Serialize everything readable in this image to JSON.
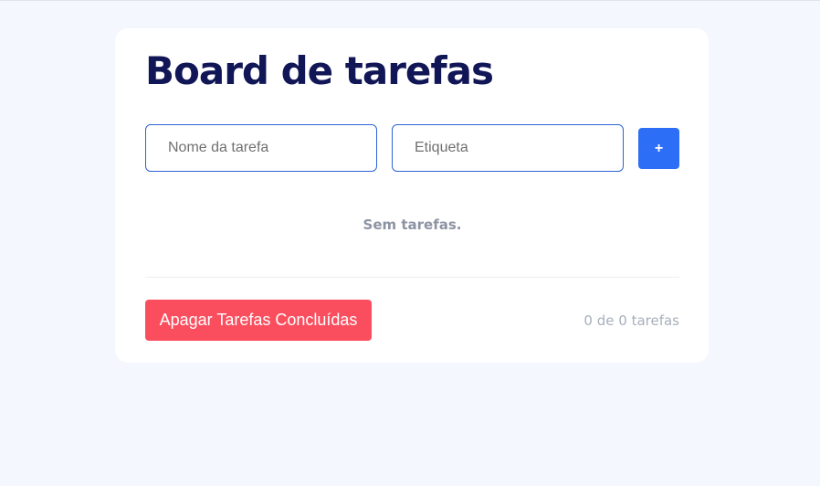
{
  "board": {
    "title": "Board de tarefas",
    "task_name_placeholder": "Nome da tarefa",
    "tag_placeholder": "Etiqueta",
    "add_label": "+",
    "empty_message": "Sem tarefas.",
    "clear_label": "Apagar Tarefas Concluídas",
    "counter": "0 de 0 tarefas"
  },
  "colors": {
    "title": "#111656",
    "accent": "#2d6ef6",
    "danger": "#fa4e5e",
    "muted": "#8c93a3",
    "background": "#f4f7fd"
  }
}
